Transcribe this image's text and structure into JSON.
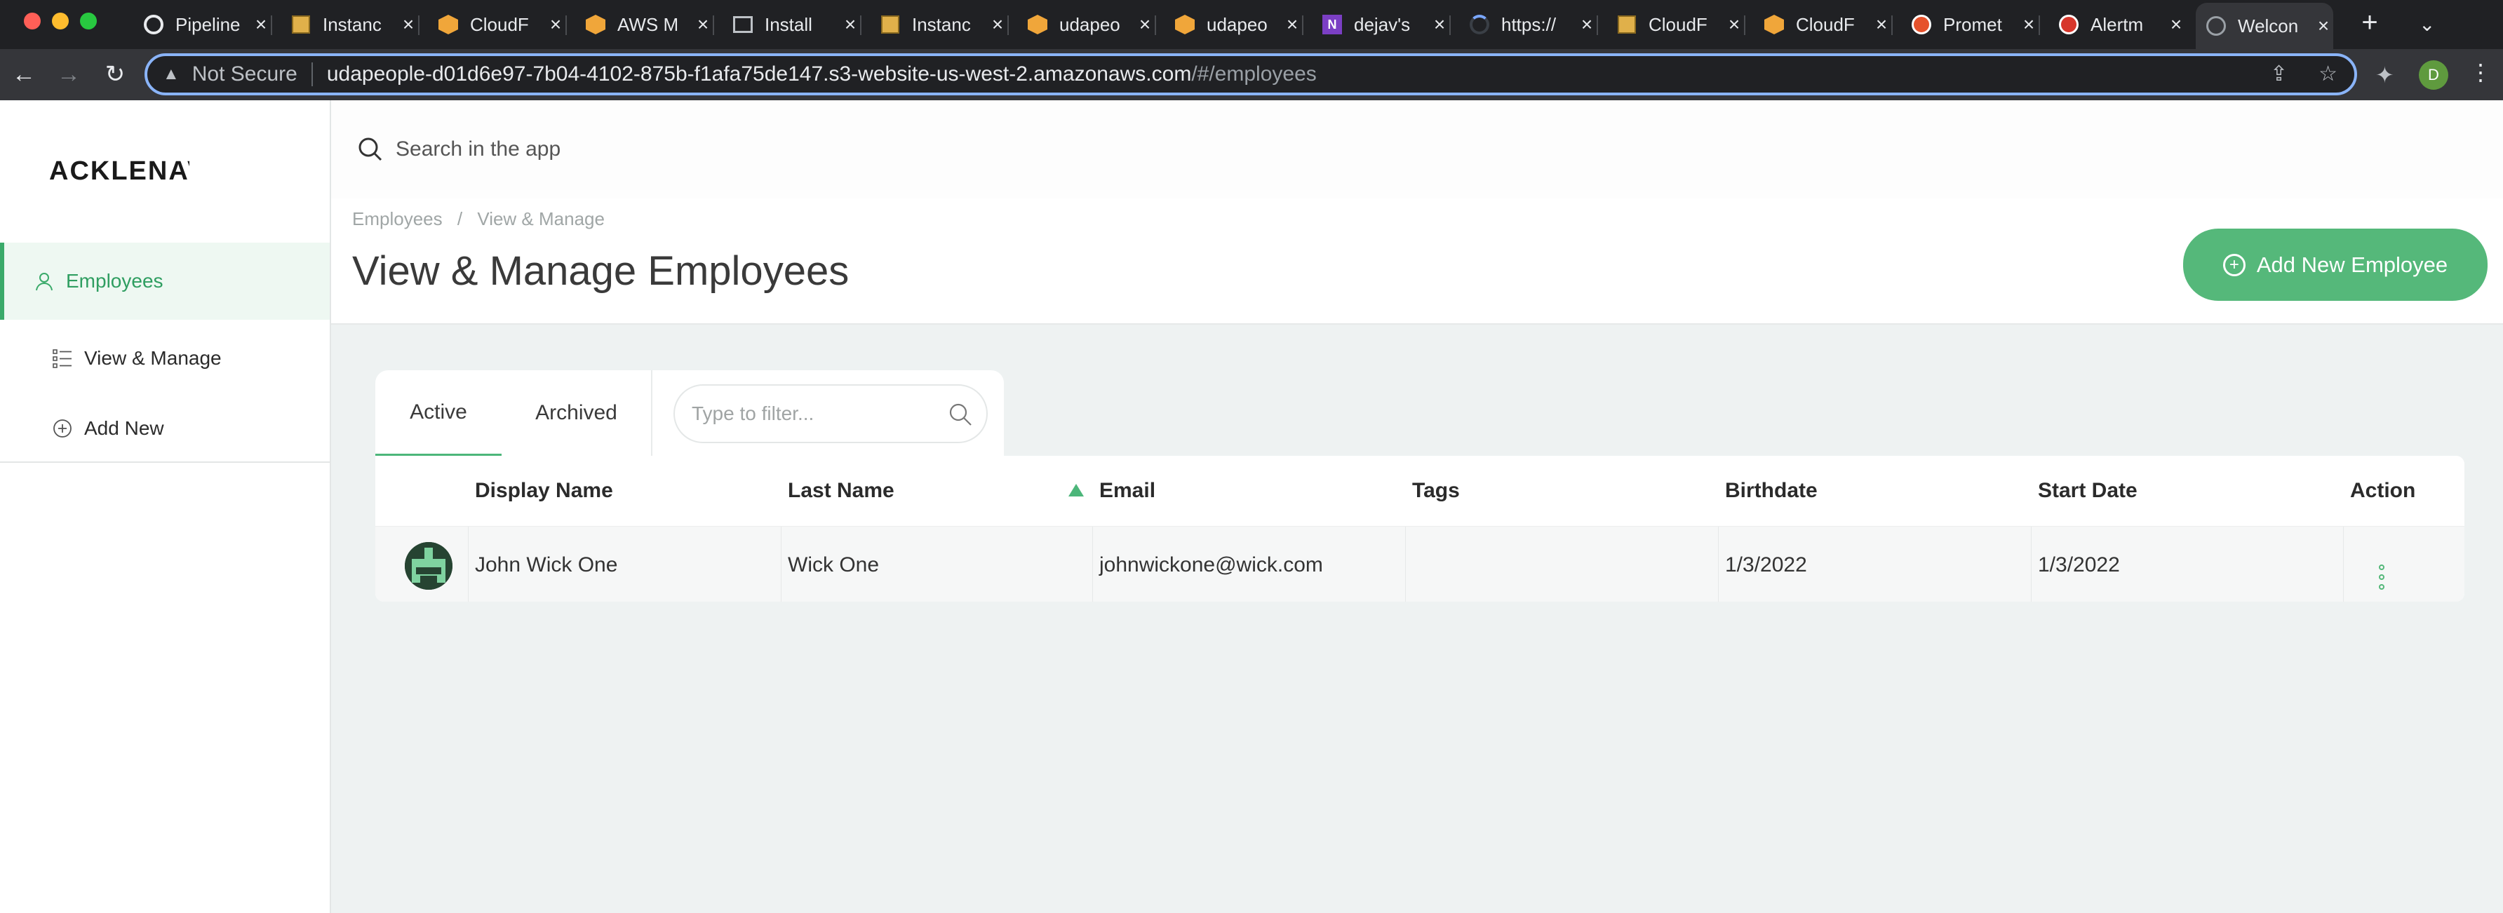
{
  "browser": {
    "tabs": [
      {
        "title": "Pipeline",
        "icon": "circle-icon"
      },
      {
        "title": "Instanc",
        "icon": "aws-box-icon"
      },
      {
        "title": "CloudF",
        "icon": "aws-cube-icon"
      },
      {
        "title": "AWS M",
        "icon": "aws-cube-icon"
      },
      {
        "title": "Install",
        "icon": "terminal-icon"
      },
      {
        "title": "Instanc",
        "icon": "aws-box-icon"
      },
      {
        "title": "udapeo",
        "icon": "aws-cube-icon"
      },
      {
        "title": "udapeo",
        "icon": "aws-cube-icon"
      },
      {
        "title": "dejav's",
        "icon": "onenote-icon"
      },
      {
        "title": "https://",
        "icon": "loading-icon"
      },
      {
        "title": "CloudF",
        "icon": "aws-box-icon"
      },
      {
        "title": "CloudF",
        "icon": "aws-cube-icon"
      },
      {
        "title": "Promet",
        "icon": "prometheus-icon"
      },
      {
        "title": "Alertm",
        "icon": "alertmanager-icon"
      },
      {
        "title": "Welcon",
        "icon": "globe-icon"
      }
    ],
    "active_tab_index": 14,
    "onenote_glyph": "N",
    "address": {
      "security_label": "Not Secure",
      "host": "udapeople-d01d6e97-7b04-4102-875b-f1afa75de147.s3-website-us-west-2.amazonaws.com",
      "path": "/#/employees"
    },
    "profile_initial": "D"
  },
  "app": {
    "logo_text": "ACKLENAVENUE",
    "sidebar": {
      "items": [
        {
          "label": "Employees",
          "icon": "user-icon",
          "active": true
        },
        {
          "label": "View & Manage",
          "icon": "list-icon",
          "active": false
        },
        {
          "label": "Add New",
          "icon": "plus-circle-icon",
          "active": false
        }
      ]
    },
    "search": {
      "placeholder": "Search in the app"
    },
    "breadcrumb": [
      "Employees",
      "/",
      "View & Manage"
    ],
    "page_title": "View & Manage Employees",
    "add_button_label": "Add New Employee",
    "tabs": [
      {
        "label": "Active",
        "active": true
      },
      {
        "label": "Archived",
        "active": false
      }
    ],
    "filter": {
      "placeholder": "Type to filter..."
    },
    "table": {
      "columns": [
        "Display Name",
        "Last Name",
        "Email",
        "Tags",
        "Birthdate",
        "Start Date",
        "Action"
      ],
      "sorted_column": "Email",
      "rows": [
        {
          "display_name": "John Wick One",
          "last_name": "Wick One",
          "email": "johnwickone@wick.com",
          "tags": "",
          "birthdate": "1/3/2022",
          "start_date": "1/3/2022"
        }
      ]
    },
    "accent_color": "#55b87a"
  }
}
